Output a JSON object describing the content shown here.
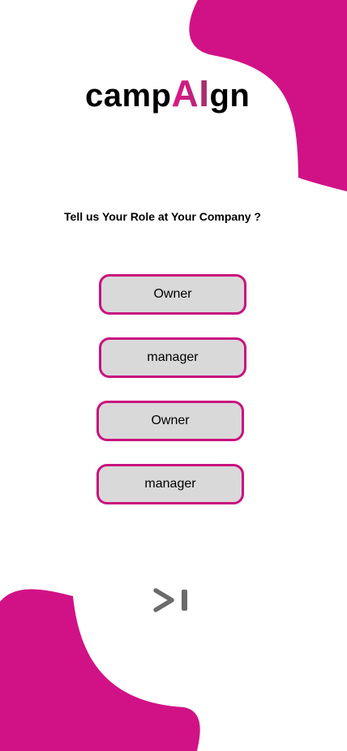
{
  "app": {
    "logo_prefix": "camp",
    "logo_highlight": "AI",
    "logo_suffix": "gn"
  },
  "prompt": {
    "question": "Tell us Your Role at Your Company ?"
  },
  "roles": [
    {
      "label": "Owner"
    },
    {
      "label": "manager"
    },
    {
      "label": "Owner"
    },
    {
      "label": "manager"
    }
  ],
  "navigation": {
    "next_icon": "skip-next-icon"
  },
  "colors": {
    "accent": "#d11286",
    "button_fill": "#d9d9d9",
    "button_border": "#c8127f",
    "icon": "#6b6b6b"
  }
}
